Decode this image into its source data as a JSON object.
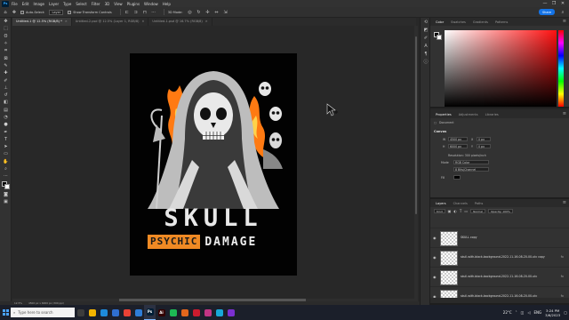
{
  "app": {
    "logo": "Ps"
  },
  "menu": [
    "File",
    "Edit",
    "Image",
    "Layer",
    "Type",
    "Select",
    "Filter",
    "3D",
    "View",
    "Plugins",
    "Window",
    "Help"
  ],
  "window_controls": [
    "—",
    "❐",
    "✕"
  ],
  "options": {
    "auto_select_label": "Auto-Select:",
    "auto_select_value": "Layer",
    "transform_label": "Show Transform Controls",
    "mode_label": "3D Mode:",
    "share_label": "Share"
  },
  "tabs": [
    {
      "label": "Untitled-1 @ 12.5% (RGB/8) *",
      "active": true
    },
    {
      "label": "Untitled-2.psd @ 12.5% (Layer 1, RGB/8)",
      "active": false
    },
    {
      "label": "Untitled-1.psd @ 16.7% (RGB/8)",
      "active": false
    }
  ],
  "design": {
    "title": "SKULL",
    "badge": "PSYCHIC",
    "word": "DAMAGE",
    "colors": {
      "badge": "#f08a24",
      "flame": "#ff7a12",
      "background": "#020202"
    }
  },
  "status": {
    "zoom": "12.5%",
    "info": "4500 px x 6000 px (300 ppi)"
  },
  "color_panel": {
    "tabs": [
      {
        "label": "Color",
        "active": true
      },
      {
        "label": "Swatches",
        "active": false
      },
      {
        "label": "Gradients",
        "active": false
      },
      {
        "label": "Patterns",
        "active": false
      }
    ],
    "hue_color": "#ff1010"
  },
  "properties": {
    "tabs": [
      {
        "label": "Properties",
        "active": true
      },
      {
        "label": "Adjustments",
        "active": false
      },
      {
        "label": "Libraries",
        "active": false
      }
    ],
    "document_label": "Document",
    "canvas_head": "Canvas",
    "w_label": "W",
    "w_value": "4500 px",
    "h_label": "H",
    "h_value": "6000 px",
    "x_label": "X",
    "y_label": "Y",
    "x_value": "0 px",
    "y_value": "0 px",
    "resolution": "Resolution: 300 pixels/inch",
    "mode_label": "Mode",
    "mode_value": "RGB Color",
    "depth_value": "8 Bits/Channel",
    "fill_label": "Fill"
  },
  "layers": {
    "tabs": [
      {
        "label": "Layers",
        "active": true
      },
      {
        "label": "Channels",
        "active": false
      },
      {
        "label": "Paths",
        "active": false
      }
    ],
    "filter_label": "Kind",
    "mode_label": "Normal",
    "opacity_label": "Opacity: 100%",
    "fill_label": "Fill: 100%",
    "items": [
      {
        "name": "SKULL copy",
        "fx": ""
      },
      {
        "name": "skull-with-black-background-2022-11-16-08-20-00-utc copy",
        "fx": "fx"
      },
      {
        "name": "skull-with-black-background-2022-11-16-08-20-00-utc",
        "fx": "fx"
      },
      {
        "name": "skull-with-black-background-2022-11-16-08-20-00-utc",
        "fx": "fx"
      }
    ]
  },
  "taskbar": {
    "search_placeholder": "Type here to search",
    "apps": [
      {
        "name": "Task View",
        "color": "#3c3c3c",
        "glyph": ""
      },
      {
        "name": "Explorer",
        "color": "#f4b400",
        "glyph": ""
      },
      {
        "name": "Edge",
        "color": "#1e8bdb",
        "glyph": ""
      },
      {
        "name": "Store",
        "color": "#2f6fd0",
        "glyph": ""
      },
      {
        "name": "Chrome",
        "color": "#e94235",
        "glyph": ""
      },
      {
        "name": "Mail",
        "color": "#2e7dd7",
        "glyph": ""
      },
      {
        "name": "Photoshop",
        "color": "#001e36",
        "glyph": "Ps"
      },
      {
        "name": "Illustrator",
        "color": "#330000",
        "glyph": "Ai"
      },
      {
        "name": "Music",
        "color": "#1db954",
        "glyph": ""
      },
      {
        "name": "Snip",
        "color": "#e3661c",
        "glyph": ""
      },
      {
        "name": "Opera",
        "color": "#cc1b2e",
        "glyph": ""
      },
      {
        "name": "App",
        "color": "#c13584",
        "glyph": ""
      },
      {
        "name": "App2",
        "color": "#18a8d8",
        "glyph": ""
      },
      {
        "name": "App3",
        "color": "#7b2fd0",
        "glyph": ""
      }
    ],
    "weather": "22°C",
    "lang": "ENG",
    "time": "3:24 PM",
    "date": "3/6/2023"
  }
}
